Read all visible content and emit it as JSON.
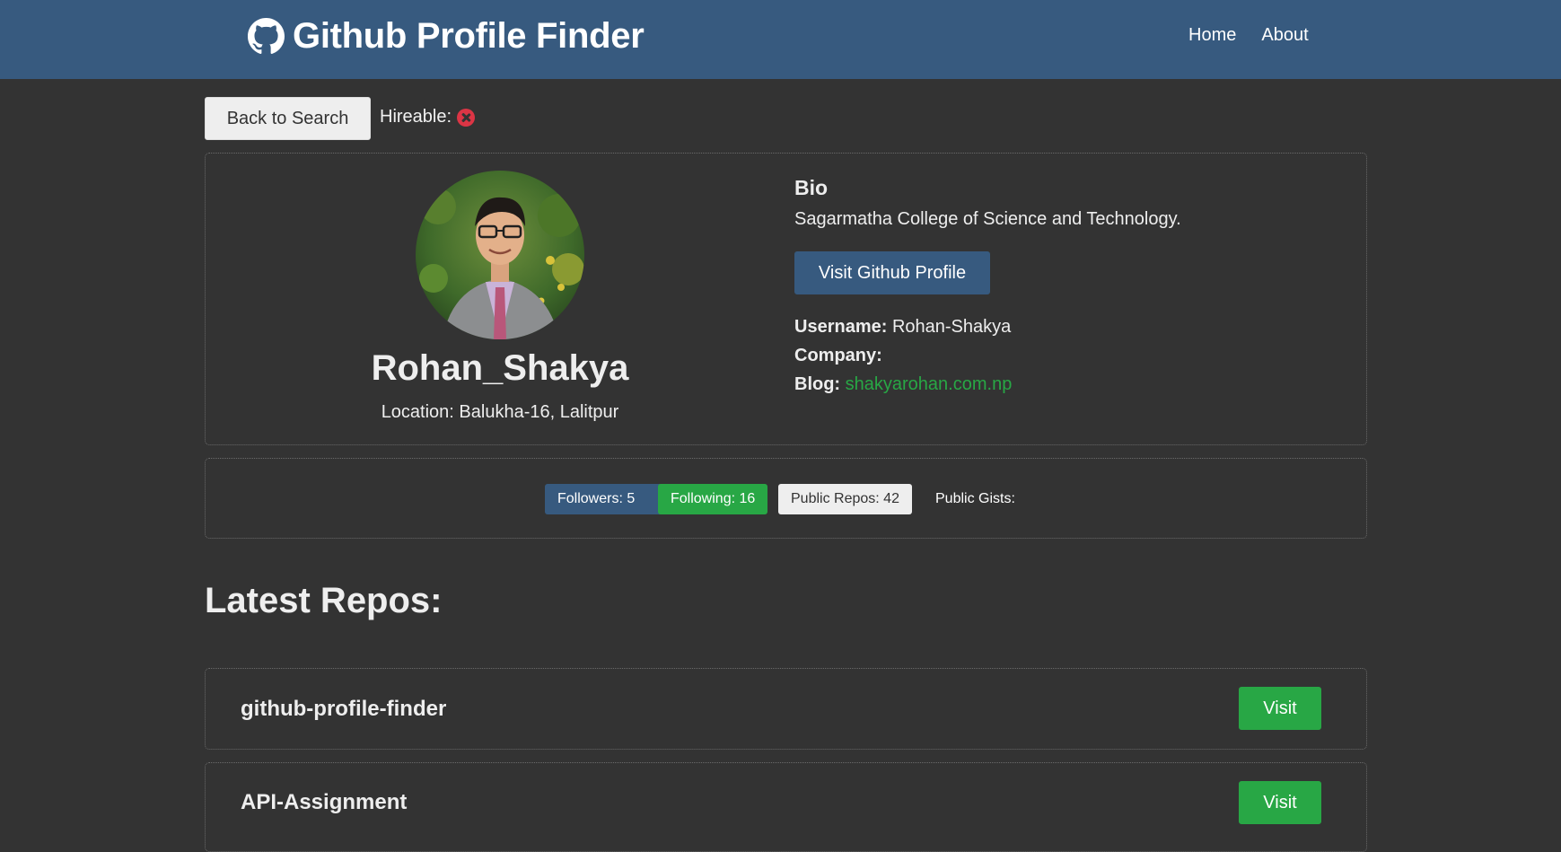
{
  "navbar": {
    "brand_icon": "github-icon",
    "brand_text": "Github Profile Finder",
    "links": [
      "Home",
      "About"
    ]
  },
  "toolbar": {
    "back_label": "Back to Search",
    "hireable_label": "Hireable:",
    "hireable_icon": "x-circle-icon"
  },
  "profile": {
    "name": "Rohan_Shakya",
    "location": "Location: Balukha-16, Lalitpur",
    "bio_heading": "Bio",
    "bio": "Sagarmatha College of Science and Technology.",
    "visit_label": "Visit Github Profile",
    "username_label": "Username:",
    "username": "Rohan-Shakya",
    "company_label": "Company:",
    "company": "",
    "blog_label": "Blog:",
    "blog": "shakyarohan.com.np"
  },
  "stats": {
    "followers": "Followers: 5",
    "following": "Following: 16",
    "public_repos": "Public Repos: 42",
    "public_gists": "Public Gists:"
  },
  "repos": {
    "title": "Latest Repos:",
    "items": [
      {
        "name": "github-profile-finder",
        "button": "Visit"
      },
      {
        "name": "API-Assignment",
        "button": "Visit"
      }
    ]
  },
  "colors": {
    "navbar": "#375a7f",
    "background": "#333333",
    "success": "#28a745",
    "danger": "#dc3545",
    "light": "#eeeeee"
  }
}
